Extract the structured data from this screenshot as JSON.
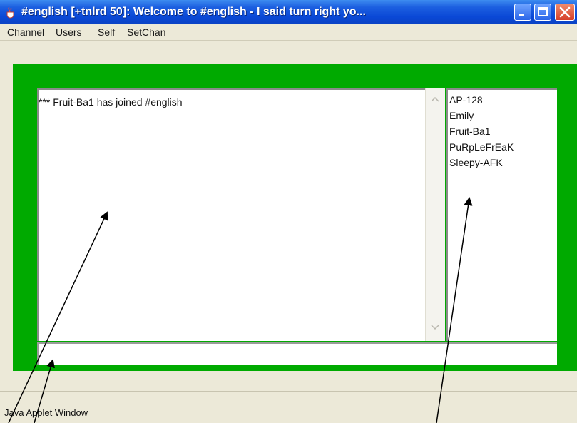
{
  "window": {
    "title": "#english [+tnlrd 50]: Welcome to #english - I said turn right yo...",
    "controls": {
      "minimize": "minimize",
      "maximize": "maximize",
      "close": "close"
    }
  },
  "menubar": {
    "items": [
      "Channel",
      "Users",
      "Self",
      "SetChan"
    ]
  },
  "chat": {
    "messages": [
      "*** Fruit-Ba1 has joined #english"
    ]
  },
  "users": {
    "list": [
      "AP-128",
      "Emily",
      "Fruit-Ba1",
      "PuRpLeFrEaK",
      "Sleepy-AFK"
    ]
  },
  "input": {
    "value": ""
  },
  "status": {
    "text": "Java Applet Window"
  },
  "icons": {
    "app": "java-cup-icon",
    "scroll_up": "chevron-up-icon",
    "scroll_down": "chevron-down-icon"
  },
  "colors": {
    "panel_bg": "#00aa00",
    "titlebar": "#0a48d6",
    "close_button": "#d6402a"
  }
}
